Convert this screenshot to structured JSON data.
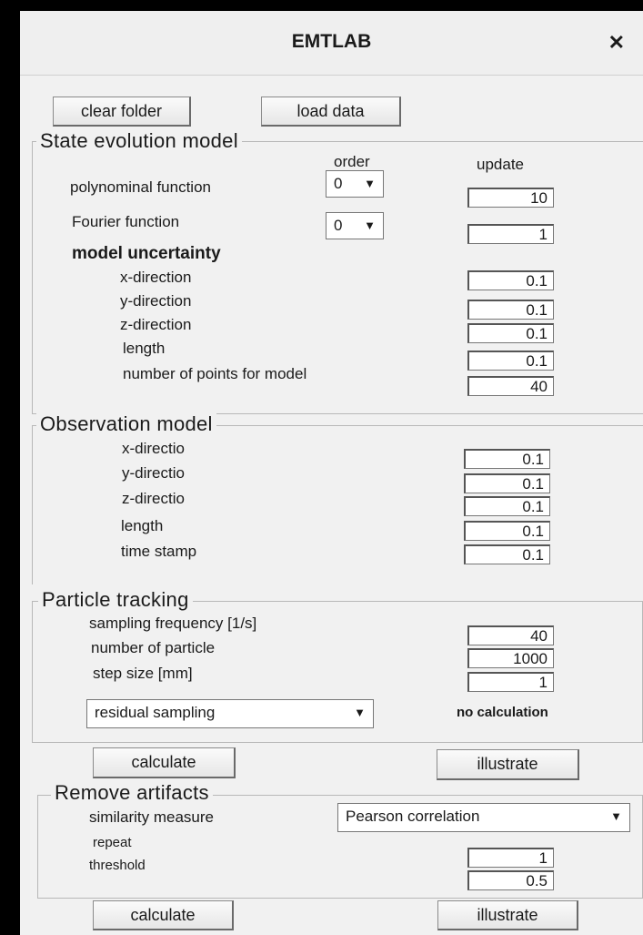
{
  "window": {
    "title": "EMTLAB"
  },
  "top_buttons": {
    "clear_folder": "clear folder",
    "load_data": "load data"
  },
  "state_model": {
    "title": "State evolution model",
    "col_order": "order",
    "col_update": "update",
    "poly_label": "polynominal function",
    "poly_order": "0",
    "poly_update": "10",
    "fourier_label": "Fourier function",
    "fourier_order": "0",
    "fourier_update": "1",
    "uncertainty_heading": "model uncertainty",
    "rows": [
      {
        "label": "x-direction",
        "value": "0.1"
      },
      {
        "label": "y-direction",
        "value": "0.1"
      },
      {
        "label": "z-direction",
        "value": "0.1"
      },
      {
        "label": "length",
        "value": "0.1"
      },
      {
        "label": "number of points for model",
        "value": "40"
      }
    ]
  },
  "observation_model": {
    "title": "Observation model",
    "rows": [
      {
        "label": "x-directio",
        "value": "0.1"
      },
      {
        "label": "y-directio",
        "value": "0.1"
      },
      {
        "label": "z-directio",
        "value": "0.1"
      },
      {
        "label": "length",
        "value": "0.1"
      },
      {
        "label": "time stamp",
        "value": "0.1"
      }
    ]
  },
  "particle_tracking": {
    "title": "Particle tracking",
    "rows": [
      {
        "label": "sampling frequency [1/s]",
        "value": "40"
      },
      {
        "label": "number of particle",
        "value": "1000"
      },
      {
        "label": "step size [mm]",
        "value": "1"
      }
    ],
    "method": "residual sampling",
    "status": "no calculation",
    "calculate": "calculate",
    "illustrate": "illustrate"
  },
  "remove_artifacts": {
    "title": "Remove artifacts",
    "similarity_label": "similarity measure",
    "similarity_value": "Pearson correlation",
    "repeat_label": "repeat",
    "repeat_value": "1",
    "threshold_label": "threshold",
    "threshold_value": "0.5",
    "calculate": "calculate",
    "illustrate": "illustrate"
  },
  "icons": {
    "close": "close-icon",
    "dropdown": "chevron-down-icon"
  }
}
